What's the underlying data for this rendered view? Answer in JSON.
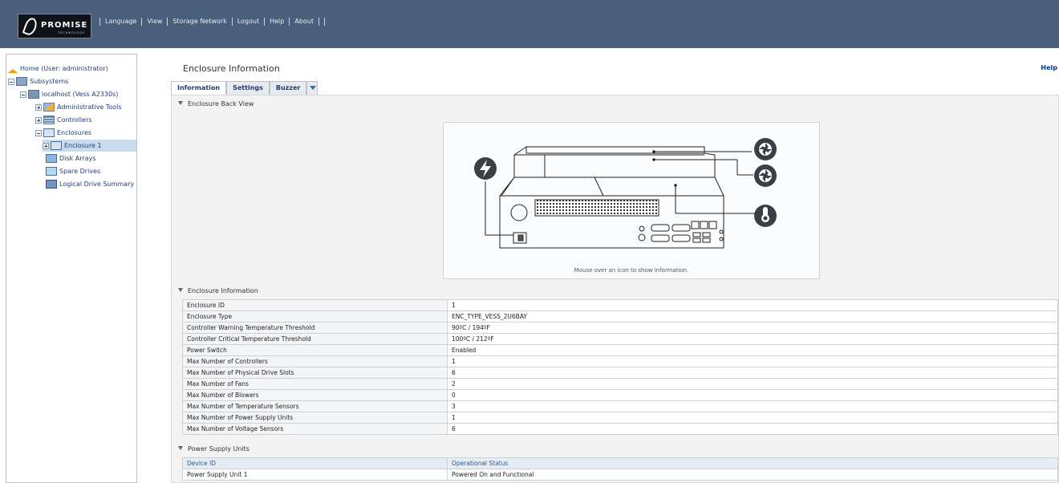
{
  "topnav": [
    "Language",
    "View",
    "Storage Network",
    "Logout",
    "Help",
    "About"
  ],
  "logo": {
    "name": "PROMISE",
    "subtitle": "TECHNOLOGY"
  },
  "sidebar": {
    "items": [
      {
        "label": "Home (User: administrator)"
      },
      {
        "label": "Subsystems"
      },
      {
        "label": "localhost (Vess A2330s)"
      },
      {
        "label": "Administrative Tools"
      },
      {
        "label": "Controllers"
      },
      {
        "label": "Enclosures"
      },
      {
        "label": "Enclosure 1"
      },
      {
        "label": "Disk Arrays"
      },
      {
        "label": "Spare Drives"
      },
      {
        "label": "Logical Drive Summary"
      }
    ]
  },
  "main": {
    "title": "Enclosure Information",
    "help": "Help",
    "tabs": [
      "Information",
      "Settings",
      "Buzzer"
    ],
    "back_view_heading": "Enclosure Back View",
    "back_view_message": "Mouse over an icon to show information.",
    "info_heading": "Enclosure Information",
    "info_rows": [
      [
        "Enclosure ID",
        "1"
      ],
      [
        "Enclosure Type",
        "ENC_TYPE_VESS_2U6BAY"
      ],
      [
        "Controller Warning Temperature Threshold",
        "90ºC / 194ºF"
      ],
      [
        "Controller Critical Temperature Threshold",
        "100ºC / 212ºF"
      ],
      [
        "Power Switch",
        "Enabled"
      ],
      [
        "Max Number of Controllers",
        "1"
      ],
      [
        "Max Number of Physical Drive Slots",
        "6"
      ],
      [
        "Max Number of Fans",
        "2"
      ],
      [
        "Max Number of Blowers",
        "0"
      ],
      [
        "Max Number of Temperature Sensors",
        "3"
      ],
      [
        "Max Number of Power Supply Units",
        "1"
      ],
      [
        "Max Number of Voltage Sensors",
        "6"
      ]
    ],
    "psu_heading": "Power Supply Units",
    "psu_headers": [
      "Device ID",
      "Operational Status"
    ],
    "psu_rows": [
      [
        "Power Supply Unit 1",
        "Powered On and Functional"
      ]
    ]
  },
  "colors": {
    "header": "#4a5f7c",
    "selected": "#c9dbed",
    "link": "#1d3f83"
  }
}
